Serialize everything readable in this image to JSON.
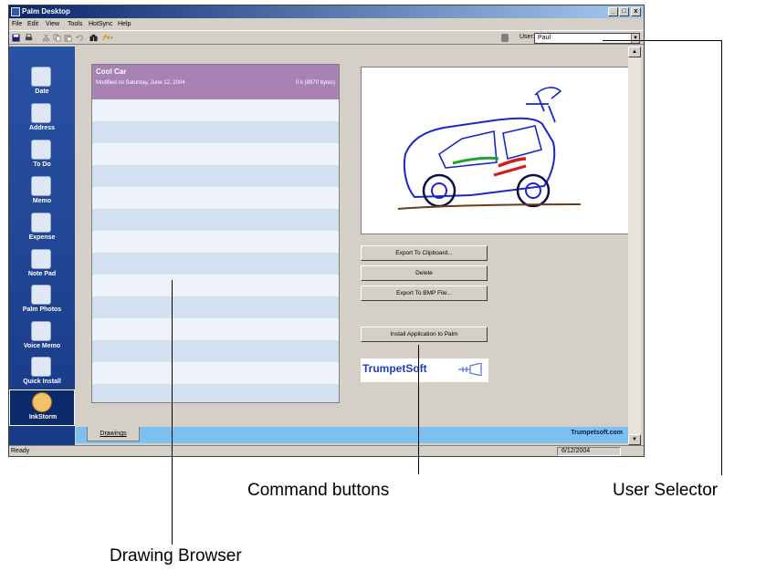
{
  "window": {
    "title": "Palm Desktop",
    "controls": [
      "_",
      "□",
      "x"
    ]
  },
  "menu": [
    "File",
    "Edit",
    "View",
    "Tools",
    "HotSync",
    "Help"
  ],
  "toolbar": {
    "user_label": "User:",
    "user_value": "Paul"
  },
  "launcher": [
    {
      "label": "Date",
      "icon": "clock-icon"
    },
    {
      "label": "Address",
      "icon": "address-card-icon"
    },
    {
      "label": "To Do",
      "icon": "checklist-icon"
    },
    {
      "label": "Memo",
      "icon": "memo-pad-icon"
    },
    {
      "label": "Expense",
      "icon": "expense-icon"
    },
    {
      "label": "Note Pad",
      "icon": "note-pad-icon"
    },
    {
      "label": "Palm Photos",
      "icon": "photos-icon"
    },
    {
      "label": "Voice Memo",
      "icon": "microphone-icon"
    },
    {
      "label": "Quick Install",
      "icon": "install-icon"
    },
    {
      "label": "InkStorm",
      "icon": "inkstorm-icon",
      "active": true
    }
  ],
  "browser": {
    "selected_title": "Cool Car",
    "selected_modified": "Modified on Saturday, June 12, 2004",
    "selected_size": "0 k (8970 bytes)"
  },
  "commands": {
    "export_clipboard": "Export To Clipboard...",
    "delete": "Delete",
    "export_bmp": "Export To BMP File...",
    "install": "Install Application to Palm"
  },
  "brand": {
    "name": "TrumpetSoft"
  },
  "tabs": {
    "drawings": "Drawings",
    "site": "Trumpetsoft.com"
  },
  "status": {
    "text": "Ready",
    "date": "6/12/2004"
  },
  "callouts": {
    "commands": "Command buttons",
    "user": "User Selector",
    "browser": "Drawing Browser"
  },
  "colors": {
    "accent": "#a882b4",
    "launcher": "#2a52a3",
    "tabbar": "#7cc0f0"
  }
}
